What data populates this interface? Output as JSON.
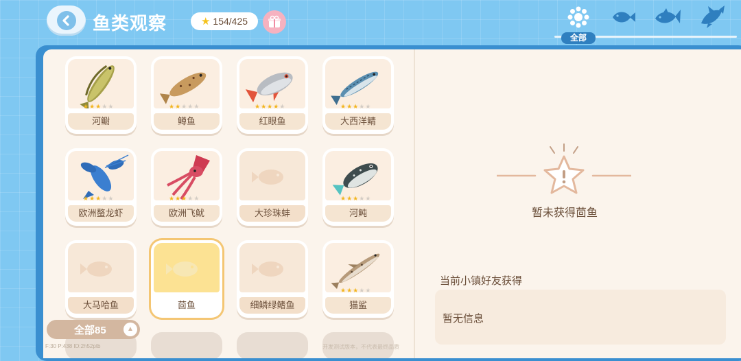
{
  "header": {
    "title": "鱼类观察",
    "star_count": "154/425",
    "category_active_label": "全部"
  },
  "colors": {
    "background": "#7fc8f2",
    "page": "#fbf4ec",
    "card_name_bg": "#f5e5d2",
    "star_on": "#f2b51d",
    "star_off": "#d3ccc4",
    "selected": "#fce293",
    "text": "#6b4f3a"
  },
  "category_tabs": [
    {
      "icon": "grid-circle-icon",
      "label": "全部"
    },
    {
      "icon": "small-fish-icon"
    },
    {
      "icon": "medium-fish-icon"
    },
    {
      "icon": "big-fish-icon"
    }
  ],
  "fish_cards": [
    {
      "name": "河鳚",
      "stars": 3,
      "icon": "blenny-fish-icon"
    },
    {
      "name": "鳟鱼",
      "stars": 2,
      "icon": "trout-icon"
    },
    {
      "name": "红眼鱼",
      "stars": 4,
      "icon": "rudd-fish-icon"
    },
    {
      "name": "大西洋鲭",
      "stars": 3,
      "icon": "mackerel-icon"
    },
    {
      "name": "欧洲螯龙虾",
      "stars": 3,
      "icon": "lobster-icon"
    },
    {
      "name": "欧洲飞鱿",
      "stars": 3,
      "icon": "squid-icon"
    },
    {
      "name": "大珍珠蚌",
      "locked": true,
      "icon": "locked-fish-silhouette-icon"
    },
    {
      "name": "河鲀",
      "stars": 3,
      "icon": "pufferfish-icon"
    },
    {
      "name": "大马哈鱼",
      "locked": true,
      "icon": "locked-fish-silhouette-icon"
    },
    {
      "name": "茴鱼",
      "locked": true,
      "selected": true,
      "icon": "locked-fish-silhouette-icon"
    },
    {
      "name": "细鳞绿鳍鱼",
      "locked": true,
      "icon": "locked-fish-silhouette-icon"
    },
    {
      "name": "猫鲨",
      "stars": 3,
      "icon": "catshark-icon"
    }
  ],
  "total_label": "全部85",
  "debug_text": "F:30 P:438 ID:2h52ptb",
  "debug_text2": "开发测试版本，不代表最终品质",
  "detail": {
    "empty_title": "暂未获得茴鱼",
    "friends_title": "当前小镇好友获得",
    "friends_empty": "暂无信息"
  }
}
